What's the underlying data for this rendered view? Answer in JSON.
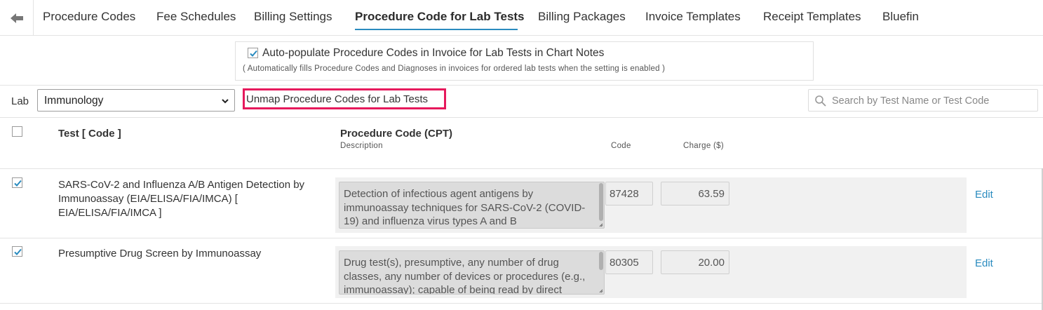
{
  "nav": {
    "tabs": [
      {
        "label": "Procedure Codes"
      },
      {
        "label": "Fee Schedules"
      },
      {
        "label": "Billing Settings"
      },
      {
        "label": "Procedure Code for Lab Tests",
        "active": true
      },
      {
        "label": "Billing Packages"
      },
      {
        "label": "Invoice Templates"
      },
      {
        "label": "Receipt Templates"
      },
      {
        "label": "Bluefin"
      }
    ]
  },
  "settings": {
    "checked": true,
    "label": "Auto-populate Procedure Codes in Invoice for Lab Tests in Chart Notes",
    "note": "( Automatically fills Procedure Codes and Diagnoses in invoices for ordered lab tests when the setting is enabled )"
  },
  "filter": {
    "lab_label": "Lab",
    "lab_value": "Immunology",
    "unmap_label": "Unmap Procedure Codes for Lab Tests",
    "search_placeholder": "Search by Test Name or Test Code"
  },
  "table": {
    "headers": {
      "test": "Test [ Code ]",
      "procedure": "Procedure Code (CPT)",
      "description": "Description",
      "code": "Code",
      "charge": "Charge ($)"
    },
    "rows": [
      {
        "checked": true,
        "test": "SARS-CoV-2 and Influenza A/B Antigen Detection by Immunoassay (EIA/ELISA/FIA/IMCA) [ EIA/ELISA/FIA/IMCA ]",
        "description": "Detection of infectious agent antigens by immunoassay techniques for SARS-CoV-2 (COVID-19) and influenza virus types A and B",
        "code": "87428",
        "charge": "63.59",
        "action": "Edit"
      },
      {
        "checked": true,
        "test": "Presumptive Drug Screen by Immunoassay",
        "description": "Drug test(s), presumptive, any number of drug classes, any number of devices or procedures (e.g., immunoassay); capable of being read by direct",
        "code": "80305",
        "charge": "20.00",
        "action": "Edit"
      }
    ]
  },
  "colors": {
    "accent": "#2a8bbf",
    "highlight": "#e6195c",
    "panel": "#f1f1f1"
  }
}
